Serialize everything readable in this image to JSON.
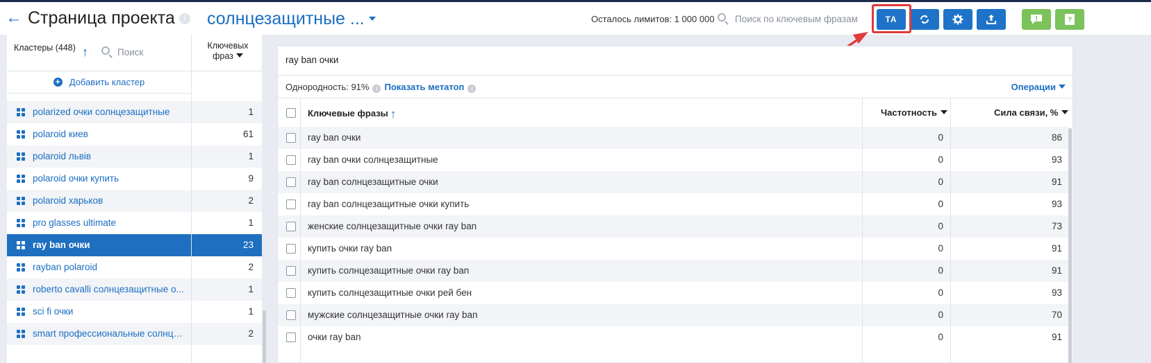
{
  "header": {
    "back_icon": "arrow-left-icon",
    "title": "Страница проекта",
    "info_icon": "i",
    "project_name": "солнцезащитные ...",
    "limits_text": "Осталось лимитов: 1 000 000",
    "search_placeholder": "Поиск по ключевым фразам",
    "buttons": {
      "ta_label": "TA",
      "sync_icon": "sync-icon",
      "settings_icon": "gear-icon",
      "export_icon": "upload-icon",
      "feedback_icon": "alert-message-icon",
      "help_icon": "help-book-icon"
    },
    "colors": {
      "accent": "#1e73c9",
      "green": "#7cc25a",
      "highlight": "#e03a3a"
    }
  },
  "clusters": {
    "label": "Кластеры (448)",
    "search_placeholder": "Поиск",
    "keyword_col": "Ключевых фраз",
    "add_cluster": "Добавить кластер",
    "items": [
      {
        "name": "polarized очки солнцезащитные",
        "count": "1"
      },
      {
        "name": "polaroid киев",
        "count": "61"
      },
      {
        "name": "polaroid львів",
        "count": "1"
      },
      {
        "name": "polaroid очки купить",
        "count": "9"
      },
      {
        "name": "polaroid харьков",
        "count": "2"
      },
      {
        "name": "pro glasses ultimate",
        "count": "1"
      },
      {
        "name": "ray ban очки",
        "count": "23",
        "selected": true
      },
      {
        "name": "rayban polaroid",
        "count": "2"
      },
      {
        "name": "roberto cavalli солнцезащитные о...",
        "count": "1"
      },
      {
        "name": "sci fi очки",
        "count": "1"
      },
      {
        "name": "smart профессиональные солнце...",
        "count": "2"
      }
    ]
  },
  "detail": {
    "cluster_title": "ray ban очки",
    "homogeneity": "Однородность: 91%",
    "show_metatop": "Показать метатоп",
    "operations": "Операции",
    "columns": {
      "phrases": "Ключевые фразы",
      "frequency": "Частотность",
      "strength": "Сила связи, %"
    },
    "rows": [
      {
        "phrase": "ray ban очки",
        "frequency": "0",
        "strength": "86"
      },
      {
        "phrase": "ray ban очки солнцезащитные",
        "frequency": "0",
        "strength": "93"
      },
      {
        "phrase": "ray ban солнцезащитные очки",
        "frequency": "0",
        "strength": "91"
      },
      {
        "phrase": "ray ban солнцезащитные очки купить",
        "frequency": "0",
        "strength": "93"
      },
      {
        "phrase": "женские солнцезащитные очки ray ban",
        "frequency": "0",
        "strength": "73"
      },
      {
        "phrase": "купить очки ray ban",
        "frequency": "0",
        "strength": "91"
      },
      {
        "phrase": "купить солнцезащитные очки ray ban",
        "frequency": "0",
        "strength": "91"
      },
      {
        "phrase": "купить солнцезащитные очки рей бен",
        "frequency": "0",
        "strength": "93"
      },
      {
        "phrase": "мужские солнцезащитные очки ray ban",
        "frequency": "0",
        "strength": "70"
      },
      {
        "phrase": "очки ray ban",
        "frequency": "0",
        "strength": "91"
      }
    ]
  }
}
